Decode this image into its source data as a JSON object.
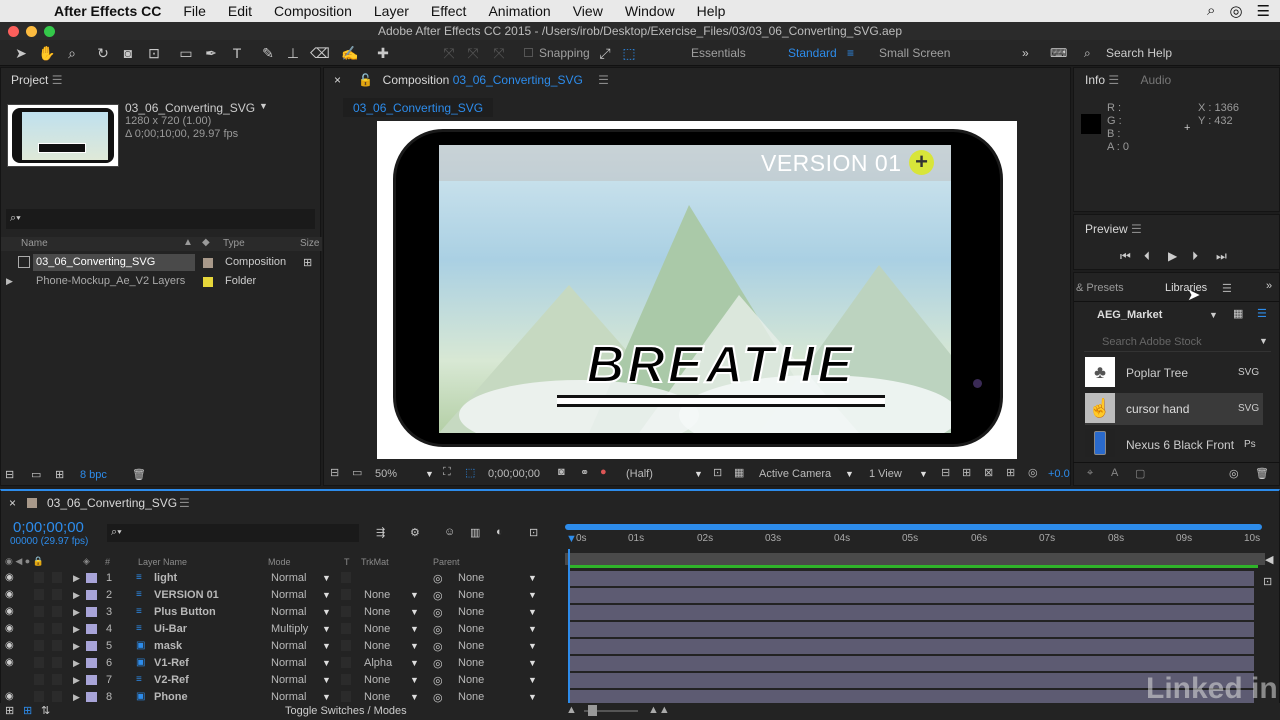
{
  "menubar": {
    "app": "After Effects CC",
    "items": [
      "File",
      "Edit",
      "Composition",
      "Layer",
      "Effect",
      "Animation",
      "View",
      "Window",
      "Help"
    ]
  },
  "window": {
    "title": "Adobe After Effects CC 2015 - /Users/irob/Desktop/Exercise_Files/03/03_06_Converting_SVG.aep"
  },
  "toolbar": {
    "snapping": "Snapping",
    "workspaces": [
      "Essentials",
      "Standard",
      "Small Screen"
    ],
    "search_help": "Search Help"
  },
  "project": {
    "title": "Project",
    "item_name": "03_06_Converting_SVG",
    "item_dims": "1280 x 720 (1.00)",
    "item_duration": "Δ 0;00;10;00, 29.97 fps",
    "columns": [
      "Name",
      "Type",
      "Size"
    ],
    "rows": [
      {
        "name": "03_06_Converting_SVG",
        "type": "Composition"
      },
      {
        "name": "Phone-Mockup_Ae_V2 Layers",
        "type": "Folder"
      }
    ],
    "bpc": "8 bpc"
  },
  "composition": {
    "label": "Composition",
    "name": "03_06_Converting_SVG",
    "tab": "03_06_Converting_SVG",
    "screen_title": "VERSION 01",
    "screen_text": "BREATHE",
    "zoom": "50%",
    "timecode": "0;00;00;00",
    "resolution": "(Half)",
    "camera": "Active Camera",
    "view": "1 View",
    "exposure": "+0.0"
  },
  "info": {
    "title": "Info",
    "tab2": "Audio",
    "r": "R :",
    "g": "G :",
    "b": "B :",
    "a": "A : 0",
    "x": "X : 1366",
    "y": "Y : 432"
  },
  "preview": {
    "title": "Preview"
  },
  "libraries": {
    "tab1": "& Presets",
    "tab2": "Libraries",
    "library": "AEG_Market",
    "search_placeholder": "Search Adobe Stock",
    "items": [
      {
        "name": "Poplar Tree",
        "type": "SVG"
      },
      {
        "name": "cursor hand",
        "type": "SVG"
      },
      {
        "name": "Nexus 6 Black Front",
        "type": "Ps"
      }
    ]
  },
  "timeline": {
    "comp_tab": "03_06_Converting_SVG",
    "timecode": "0;00;00;00",
    "fps": "00000 (29.97 fps)",
    "columns": {
      "num": "#",
      "layer": "Layer Name",
      "mode": "Mode",
      "t": "T",
      "trkmat": "TrkMat",
      "parent": "Parent"
    },
    "ruler": [
      "0s",
      "01s",
      "02s",
      "03s",
      "04s",
      "05s",
      "06s",
      "07s",
      "08s",
      "09s",
      "10s"
    ],
    "layers": [
      {
        "num": "1",
        "name": "light",
        "mode": "Normal",
        "trkmat": "",
        "parent": "None"
      },
      {
        "num": "2",
        "name": "VERSION 01",
        "mode": "Normal",
        "trkmat": "None",
        "parent": "None"
      },
      {
        "num": "3",
        "name": "Plus Button",
        "mode": "Normal",
        "trkmat": "None",
        "parent": "None"
      },
      {
        "num": "4",
        "name": "Ui-Bar",
        "mode": "Multiply",
        "trkmat": "None",
        "parent": "None"
      },
      {
        "num": "5",
        "name": "mask",
        "mode": "Normal",
        "trkmat": "None",
        "parent": "None"
      },
      {
        "num": "6",
        "name": "V1-Ref",
        "mode": "Normal",
        "trkmat": "Alpha",
        "parent": "None"
      },
      {
        "num": "7",
        "name": "V2-Ref",
        "mode": "Normal",
        "trkmat": "None",
        "parent": "None"
      },
      {
        "num": "8",
        "name": "Phone",
        "mode": "Normal",
        "trkmat": "None",
        "parent": "None"
      }
    ],
    "toggle": "Toggle Switches / Modes"
  },
  "watermark": "Linked in",
  "colors": {
    "accent": "#2d8ceb",
    "track": "#5d5b72",
    "label": "#a8a4d8"
  }
}
